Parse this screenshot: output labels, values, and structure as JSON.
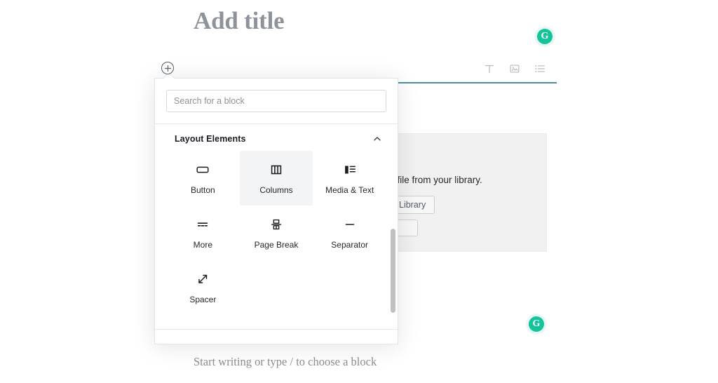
{
  "editor": {
    "title_placeholder": "Add title",
    "default_block_prompt": "Start writing or type / to choose a block",
    "accent_color": "#2a7c8f"
  },
  "block_toolbar": {
    "items": [
      {
        "icon": "paragraph-text-icon",
        "label": "Change block type: Paragraph"
      },
      {
        "icon": "image-icon",
        "label": "Change block type: Image"
      },
      {
        "icon": "list-icon",
        "label": "Change block type: List"
      }
    ]
  },
  "grammarly": {
    "glyph": "G",
    "color": "#15c39a",
    "badges": [
      {
        "name": "grammarly-badge-title"
      },
      {
        "name": "grammarly-badge-content"
      }
    ]
  },
  "media_block": {
    "description": "ct a file from your library.",
    "library_button": "Library",
    "upload_button": "",
    "background": "#f1f1f1"
  },
  "inserter": {
    "toggle_label": "Add block",
    "toggle_icon": "plus-circle-icon",
    "search": {
      "placeholder": "Search for a block",
      "value": ""
    },
    "category": {
      "title": "Layout Elements",
      "collapse_icon": "chevron-up-icon",
      "expanded": true
    },
    "blocks": [
      {
        "label": "Button",
        "icon": "button-icon",
        "hovered": false
      },
      {
        "label": "Columns",
        "icon": "columns-icon",
        "hovered": true
      },
      {
        "label": "Media & Text",
        "icon": "media-text-icon",
        "hovered": false
      },
      {
        "label": "More",
        "icon": "more-icon",
        "hovered": false
      },
      {
        "label": "Page Break",
        "icon": "page-break-icon",
        "hovered": false
      },
      {
        "label": "Separator",
        "icon": "separator-icon",
        "hovered": false
      },
      {
        "label": "Spacer",
        "icon": "spacer-icon",
        "hovered": false
      }
    ],
    "scrollbar": {
      "visible": true
    }
  }
}
